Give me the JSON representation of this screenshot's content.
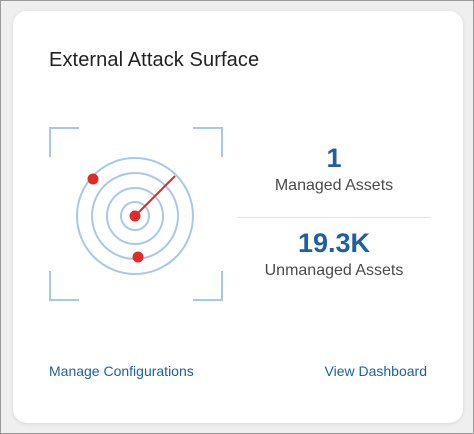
{
  "card": {
    "title": "External Attack Surface",
    "illustration_icon": "radar-scan-icon",
    "stats": {
      "managed": {
        "value": "1",
        "label": "Managed Assets"
      },
      "unmanaged": {
        "value": "19.3K",
        "label": "Unmanaged Assets"
      }
    },
    "links": {
      "manage_configurations": "Manage Configurations",
      "view_dashboard": "View Dashboard"
    }
  },
  "colors": {
    "accent": "#1f5fa8",
    "radar_lines": "#a9c8e8",
    "radar_dots": "#e02b2b"
  }
}
